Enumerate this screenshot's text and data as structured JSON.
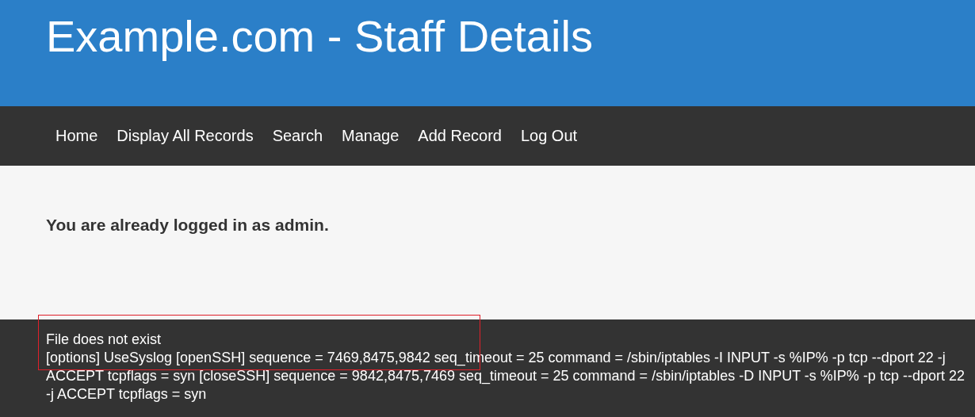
{
  "header": {
    "title": "Example.com - Staff Details"
  },
  "nav": {
    "items": [
      {
        "label": "Home"
      },
      {
        "label": "Display All Records"
      },
      {
        "label": "Search"
      },
      {
        "label": "Manage"
      },
      {
        "label": "Add Record"
      },
      {
        "label": "Log Out"
      }
    ]
  },
  "main": {
    "message": "You are already logged in as admin."
  },
  "footer": {
    "lines": [
      "File does not exist",
      "[options] UseSyslog [openSSH] sequence = 7469,8475,9842 seq_timeout = 25 command = /sbin/iptables -I INPUT -s %IP% -p tcp --dport 22 -j ACCEPT tcpflags = syn [closeSSH] sequence = 9842,8475,7469 seq_timeout = 25 command = /sbin/iptables -D INPUT -s %IP% -p tcp --dport 22 -j ACCEPT tcpflags = syn"
    ]
  }
}
